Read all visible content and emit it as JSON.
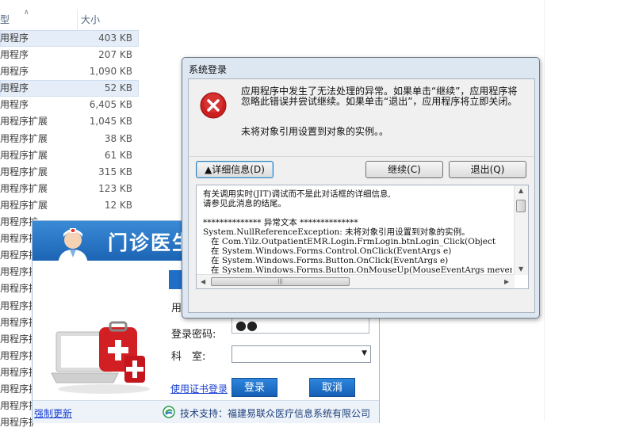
{
  "explorer": {
    "columns": {
      "type": "型",
      "size": "大小"
    },
    "rows": [
      {
        "type": "用程序",
        "size": "403 KB",
        "selected": true
      },
      {
        "type": "用程序",
        "size": "207 KB",
        "selected": false
      },
      {
        "type": "用程序",
        "size": "1,090 KB",
        "selected": false
      },
      {
        "type": "用程序",
        "size": "52 KB",
        "selected": true
      },
      {
        "type": "用程序",
        "size": "6,405 KB",
        "selected": false
      },
      {
        "type": "用程序扩展",
        "size": "1,045 KB",
        "selected": false
      },
      {
        "type": "用程序扩展",
        "size": "38 KB",
        "selected": false
      },
      {
        "type": "用程序扩展",
        "size": "61 KB",
        "selected": false
      },
      {
        "type": "用程序扩展",
        "size": "315 KB",
        "selected": false
      },
      {
        "type": "用程序扩展",
        "size": "123 KB",
        "selected": false
      },
      {
        "type": "用程序扩展",
        "size": "12 KB",
        "selected": false
      },
      {
        "type": "用程序扩",
        "size": "",
        "selected": false
      },
      {
        "type": "用程序扩",
        "size": "",
        "selected": false
      },
      {
        "type": "用程序扩",
        "size": "",
        "selected": false
      },
      {
        "type": "用程序扩",
        "size": "",
        "selected": false
      },
      {
        "type": "用程序扩",
        "size": "",
        "selected": false
      },
      {
        "type": "用程序扩",
        "size": "",
        "selected": false
      },
      {
        "type": "用程序扩",
        "size": "",
        "selected": false
      },
      {
        "type": "用程序扩",
        "size": "",
        "selected": false
      },
      {
        "type": "用程序扩",
        "size": "",
        "selected": false
      },
      {
        "type": "用程序扩",
        "size": "",
        "selected": false
      },
      {
        "type": "用程序扩",
        "size": "",
        "selected": false
      },
      {
        "type": "用程序扩",
        "size": "",
        "selected": false
      },
      {
        "type": "用程序扩",
        "size": "",
        "selected": false
      }
    ]
  },
  "login": {
    "title": "门诊医生",
    "user_label": "用",
    "password_label": "登录密码:",
    "password_value": "●●",
    "dept_label": "科　室:",
    "dept_value": "",
    "cert_link": "使用证书登录",
    "login_button": "登录",
    "cancel_button": "取消",
    "support": "技术支持：福建易联众医疗信息系统有限公司",
    "force_update": "强制更新"
  },
  "dialog": {
    "title": "系统登录",
    "message": "应用程序中发生了无法处理的异常。如果单击“继续”，应用程序将忽略此错误并尝试继续。如果单击“退出”，应用程序将立即关闭。",
    "message2": "未将对象引用设置到对象的实例。。",
    "details_button": "▲详细信息(D)",
    "continue_button": "继续(C)",
    "quit_button": "退出(Q)",
    "details_text": "有关调用实时(JIT)调试而不是此对话框的详细信息,\n请参见此消息的结尾。\n\n************** 异常文本 **************\nSystem.NullReferenceException: 未将对象引用设置到对象的实例。\n   在 Com.Yilz.OutpatientEMR.Login.FrmLogin.btnLogin_Click(Object\n   在 System.Windows.Forms.Control.OnClick(EventArgs e)\n   在 System.Windows.Forms.Button.OnClick(EventArgs e)\n   在 System.Windows.Forms.Button.OnMouseUp(MouseEventArgs mevent)\n   在 System.Windows.Forms.Control.WmMouseUp(Message& m, MouseButt"
  },
  "icons": {
    "error": "error-x-icon",
    "doctor": "doctor-avatar-icon",
    "support": "support-logo-icon",
    "medkit": "laptop-medkit-illustration"
  },
  "colors": {
    "login_header": "#1c64b5",
    "error_red": "#cc1f1f",
    "link_blue": "#1a3fd1",
    "dialog_frame": "#dde7f2"
  }
}
